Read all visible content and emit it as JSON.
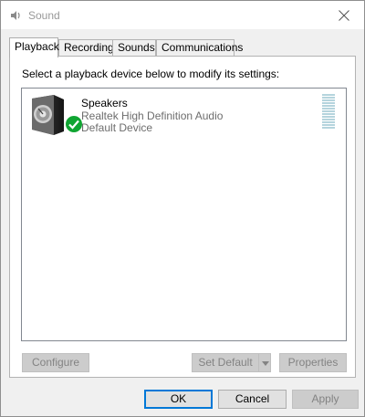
{
  "window": {
    "title": "Sound",
    "close_label": "Close"
  },
  "tabs": [
    {
      "label": "Playback",
      "active": true
    },
    {
      "label": "Recording",
      "active": false
    },
    {
      "label": "Sounds",
      "active": false
    },
    {
      "label": "Communications",
      "active": false
    }
  ],
  "panel": {
    "instruction": "Select a playback device below to modify its settings:"
  },
  "devices": [
    {
      "name": "Speakers",
      "driver": "Realtek High Definition Audio",
      "status": "Default Device",
      "icon": "speaker-icon",
      "default_badge": "check-badge-icon",
      "badge_color": "#10a532",
      "level": 0
    }
  ],
  "panel_buttons": {
    "configure": "Configure",
    "set_default": "Set Default",
    "properties": "Properties"
  },
  "dialog_buttons": {
    "ok": "OK",
    "cancel": "Cancel",
    "apply": "Apply"
  },
  "colors": {
    "accent": "#0078d7",
    "meter": "#b5d4dd"
  }
}
